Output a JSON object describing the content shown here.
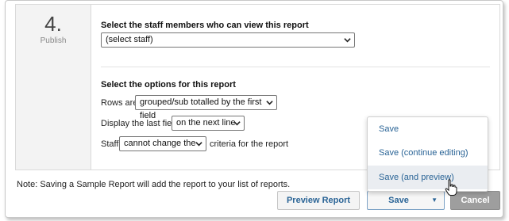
{
  "step": {
    "number": "4.",
    "label": "Publish"
  },
  "staff_section": {
    "title": "Select the staff members who can view this report",
    "select_value": "(select staff)"
  },
  "options_section": {
    "title": "Select the options for this report",
    "rows_label": "Rows are",
    "rows_value": "grouped/sub totalled by the first field",
    "display_label": "Display the last field",
    "display_value": "on the next line",
    "staff_label": "Staff",
    "staff_value": "cannot change the",
    "criteria_label": "criteria for the report"
  },
  "footer": {
    "note": "Note: Saving a Sample Report will add the report to your list of reports.",
    "preview_button": "Preview Report",
    "save_button": "Save",
    "cancel_button": "Cancel"
  },
  "save_menu": {
    "items": [
      "Save",
      "Save (continue editing)",
      "Save (and preview)"
    ],
    "highlighted_index": 2
  },
  "icons": {
    "dropdown": "chevron-down-icon",
    "save_caret": "caret-down-icon",
    "cursor": "hand-pointer-icon"
  },
  "colors": {
    "link_blue": "#2a6496",
    "cancel_gray": "#9e9e9e",
    "step_bg": "#f3f3f3",
    "menu_hover": "#eaedf1"
  }
}
